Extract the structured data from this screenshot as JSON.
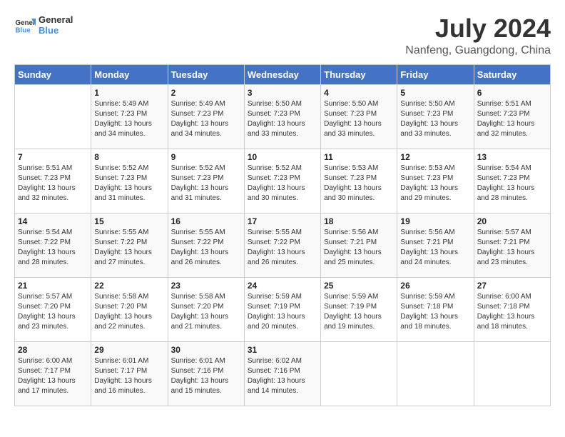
{
  "header": {
    "logo_line1": "General",
    "logo_line2": "Blue",
    "month": "July 2024",
    "location": "Nanfeng, Guangdong, China"
  },
  "weekdays": [
    "Sunday",
    "Monday",
    "Tuesday",
    "Wednesday",
    "Thursday",
    "Friday",
    "Saturday"
  ],
  "weeks": [
    [
      {
        "day": "",
        "info": ""
      },
      {
        "day": "1",
        "info": "Sunrise: 5:49 AM\nSunset: 7:23 PM\nDaylight: 13 hours\nand 34 minutes."
      },
      {
        "day": "2",
        "info": "Sunrise: 5:49 AM\nSunset: 7:23 PM\nDaylight: 13 hours\nand 34 minutes."
      },
      {
        "day": "3",
        "info": "Sunrise: 5:50 AM\nSunset: 7:23 PM\nDaylight: 13 hours\nand 33 minutes."
      },
      {
        "day": "4",
        "info": "Sunrise: 5:50 AM\nSunset: 7:23 PM\nDaylight: 13 hours\nand 33 minutes."
      },
      {
        "day": "5",
        "info": "Sunrise: 5:50 AM\nSunset: 7:23 PM\nDaylight: 13 hours\nand 33 minutes."
      },
      {
        "day": "6",
        "info": "Sunrise: 5:51 AM\nSunset: 7:23 PM\nDaylight: 13 hours\nand 32 minutes."
      }
    ],
    [
      {
        "day": "7",
        "info": "Sunrise: 5:51 AM\nSunset: 7:23 PM\nDaylight: 13 hours\nand 32 minutes."
      },
      {
        "day": "8",
        "info": "Sunrise: 5:52 AM\nSunset: 7:23 PM\nDaylight: 13 hours\nand 31 minutes."
      },
      {
        "day": "9",
        "info": "Sunrise: 5:52 AM\nSunset: 7:23 PM\nDaylight: 13 hours\nand 31 minutes."
      },
      {
        "day": "10",
        "info": "Sunrise: 5:52 AM\nSunset: 7:23 PM\nDaylight: 13 hours\nand 30 minutes."
      },
      {
        "day": "11",
        "info": "Sunrise: 5:53 AM\nSunset: 7:23 PM\nDaylight: 13 hours\nand 30 minutes."
      },
      {
        "day": "12",
        "info": "Sunrise: 5:53 AM\nSunset: 7:23 PM\nDaylight: 13 hours\nand 29 minutes."
      },
      {
        "day": "13",
        "info": "Sunrise: 5:54 AM\nSunset: 7:23 PM\nDaylight: 13 hours\nand 28 minutes."
      }
    ],
    [
      {
        "day": "14",
        "info": "Sunrise: 5:54 AM\nSunset: 7:22 PM\nDaylight: 13 hours\nand 28 minutes."
      },
      {
        "day": "15",
        "info": "Sunrise: 5:55 AM\nSunset: 7:22 PM\nDaylight: 13 hours\nand 27 minutes."
      },
      {
        "day": "16",
        "info": "Sunrise: 5:55 AM\nSunset: 7:22 PM\nDaylight: 13 hours\nand 26 minutes."
      },
      {
        "day": "17",
        "info": "Sunrise: 5:55 AM\nSunset: 7:22 PM\nDaylight: 13 hours\nand 26 minutes."
      },
      {
        "day": "18",
        "info": "Sunrise: 5:56 AM\nSunset: 7:21 PM\nDaylight: 13 hours\nand 25 minutes."
      },
      {
        "day": "19",
        "info": "Sunrise: 5:56 AM\nSunset: 7:21 PM\nDaylight: 13 hours\nand 24 minutes."
      },
      {
        "day": "20",
        "info": "Sunrise: 5:57 AM\nSunset: 7:21 PM\nDaylight: 13 hours\nand 23 minutes."
      }
    ],
    [
      {
        "day": "21",
        "info": "Sunrise: 5:57 AM\nSunset: 7:20 PM\nDaylight: 13 hours\nand 23 minutes."
      },
      {
        "day": "22",
        "info": "Sunrise: 5:58 AM\nSunset: 7:20 PM\nDaylight: 13 hours\nand 22 minutes."
      },
      {
        "day": "23",
        "info": "Sunrise: 5:58 AM\nSunset: 7:20 PM\nDaylight: 13 hours\nand 21 minutes."
      },
      {
        "day": "24",
        "info": "Sunrise: 5:59 AM\nSunset: 7:19 PM\nDaylight: 13 hours\nand 20 minutes."
      },
      {
        "day": "25",
        "info": "Sunrise: 5:59 AM\nSunset: 7:19 PM\nDaylight: 13 hours\nand 19 minutes."
      },
      {
        "day": "26",
        "info": "Sunrise: 5:59 AM\nSunset: 7:18 PM\nDaylight: 13 hours\nand 18 minutes."
      },
      {
        "day": "27",
        "info": "Sunrise: 6:00 AM\nSunset: 7:18 PM\nDaylight: 13 hours\nand 18 minutes."
      }
    ],
    [
      {
        "day": "28",
        "info": "Sunrise: 6:00 AM\nSunset: 7:17 PM\nDaylight: 13 hours\nand 17 minutes."
      },
      {
        "day": "29",
        "info": "Sunrise: 6:01 AM\nSunset: 7:17 PM\nDaylight: 13 hours\nand 16 minutes."
      },
      {
        "day": "30",
        "info": "Sunrise: 6:01 AM\nSunset: 7:16 PM\nDaylight: 13 hours\nand 15 minutes."
      },
      {
        "day": "31",
        "info": "Sunrise: 6:02 AM\nSunset: 7:16 PM\nDaylight: 13 hours\nand 14 minutes."
      },
      {
        "day": "",
        "info": ""
      },
      {
        "day": "",
        "info": ""
      },
      {
        "day": "",
        "info": ""
      }
    ]
  ]
}
